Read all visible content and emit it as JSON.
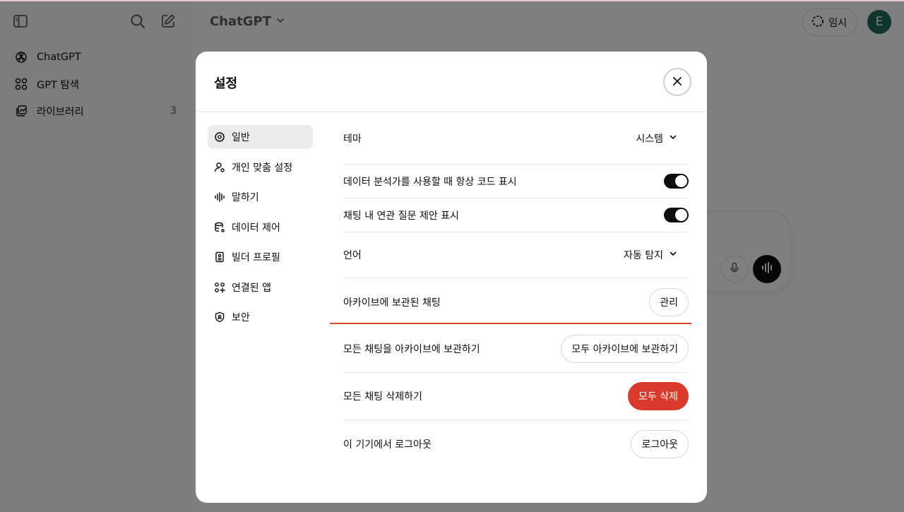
{
  "app": {
    "model_selector": "ChatGPT",
    "temporary_label": "임시",
    "avatar_initial": "E"
  },
  "sidebar": {
    "items": [
      {
        "label": "ChatGPT",
        "icon": "openai-logo-icon"
      },
      {
        "label": "GPT 탐색",
        "icon": "grid-icon"
      },
      {
        "label": "라이브러리",
        "icon": "library-icon",
        "count": "3"
      }
    ]
  },
  "settings": {
    "title": "설정",
    "tabs": [
      {
        "label": "일반",
        "icon": "gear-icon",
        "active": true
      },
      {
        "label": "개인 맞춤 설정",
        "icon": "person-settings-icon"
      },
      {
        "label": "말하기",
        "icon": "waveform-icon"
      },
      {
        "label": "데이터 제어",
        "icon": "database-icon"
      },
      {
        "label": "빌더 프로필",
        "icon": "id-card-icon"
      },
      {
        "label": "연결된 앱",
        "icon": "apps-icon"
      },
      {
        "label": "보안",
        "icon": "shield-icon"
      }
    ],
    "rows": {
      "theme": {
        "label": "테마",
        "value": "시스템"
      },
      "code_display": {
        "label": "데이터 분석가를 사용할 때 항상 코드 표시",
        "enabled": true
      },
      "suggestions": {
        "label": "채팅 내 연관 질문 제안 표시",
        "enabled": true
      },
      "language": {
        "label": "언어",
        "value": "자동 탐지"
      },
      "archived": {
        "label": "아카이브에 보관된 채팅",
        "button": "관리"
      },
      "archive_all": {
        "label": "모든 채팅을 아카이브에 보관하기",
        "button": "모두 아카이브에 보관하기"
      },
      "delete_all": {
        "label": "모든 채팅 삭제하기",
        "button": "모두 삭제"
      },
      "logout": {
        "label": "이 기기에서 로그아웃",
        "button": "로그아웃"
      }
    }
  },
  "colors": {
    "danger": "#d93a2b",
    "highlight_line": "#d94a30",
    "avatar": "#1f6b5b"
  }
}
